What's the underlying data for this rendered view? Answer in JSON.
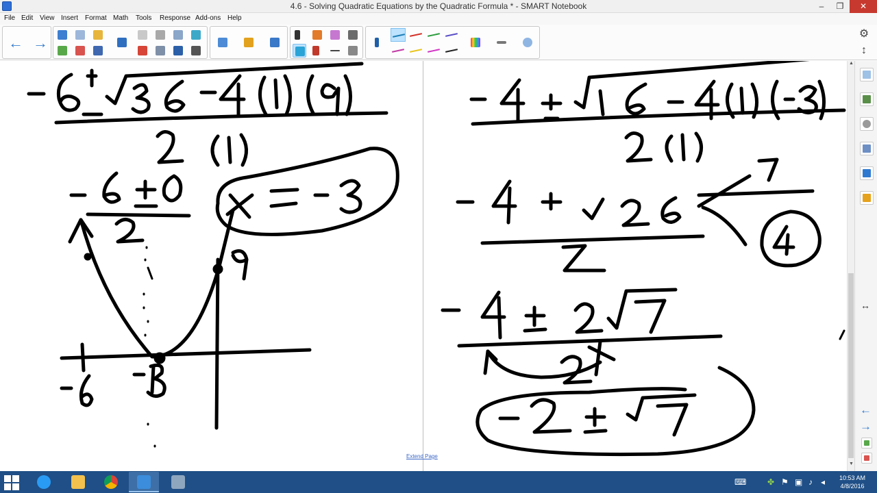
{
  "window": {
    "title": "4.6 - Solving Quadratic Equations by the Quadratic Formula * - SMART Notebook",
    "minimize_glyph": "–",
    "maximize_glyph": "❐",
    "close_glyph": "✕"
  },
  "menu": [
    "File",
    "Edit",
    "View",
    "Insert",
    "Format",
    "Math",
    "Tools",
    "Response",
    "Add-ons",
    "Help"
  ],
  "toolbar": {
    "back_glyph": "←",
    "forward_glyph": "→",
    "icons": [
      "undo-icon",
      "redo-icon",
      "open-file-icon",
      "add-page-icon",
      "delete-page-icon",
      "save-icon",
      "display-screen-icon",
      "paste-icon",
      "delete-icon",
      "table-icon",
      "screen-shade-icon",
      "fullscreen-icon",
      "capture-icon",
      "math-icon",
      "lesson-activity-icon",
      "addons-icon",
      "select-icon",
      "pens-icon",
      "text-icon",
      "lines-icon",
      "eraser-icon",
      "shapes-icon",
      "fill-icon",
      "properties-icon",
      "pen-icon",
      "color-palette-icon",
      "line-style-icon",
      "magic-pen-icon"
    ],
    "pen_colors": [
      "#1d7fb6",
      "#d4322a",
      "#2e9e3f",
      "#5b4fc7",
      "#c23aa5",
      "#e8c51e",
      "#d236c4",
      "#222222"
    ],
    "settings_glyph": "⚙",
    "move_glyph": "↕"
  },
  "canvas": {
    "extend_page_label": "Extend Page",
    "ink_color": "#000000"
  },
  "sidebar": {
    "tabs": [
      "page-sorter-icon",
      "gallery-icon",
      "attachments-icon",
      "properties-icon",
      "addons-icon",
      "lesson-activity-builder-icon"
    ],
    "resize_glyph": "↔",
    "prev_glyph": "←",
    "next_glyph": "→"
  },
  "taskbar": {
    "apps": [
      "internet-explorer-icon",
      "file-explorer-icon",
      "chrome-icon",
      "smart-notebook-icon",
      "smart-tools-icon"
    ],
    "time": "10:53 AM",
    "date": "4/8/2016"
  }
}
